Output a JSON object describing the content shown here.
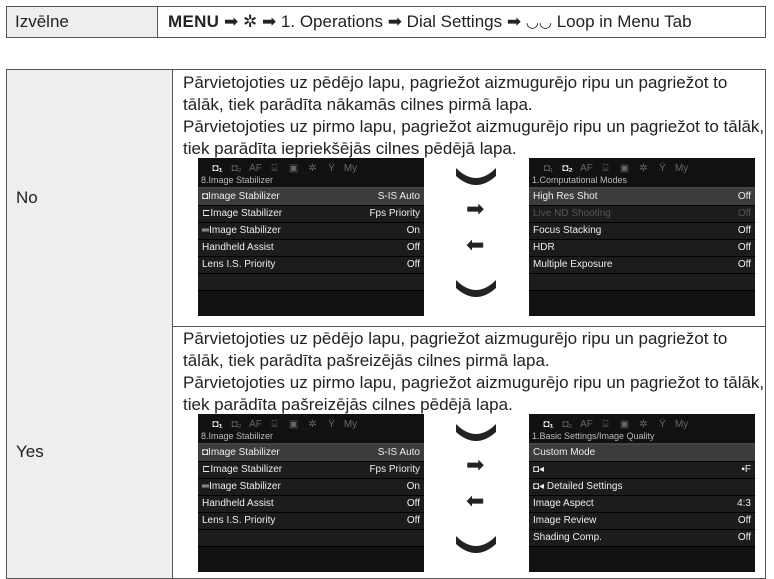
{
  "header": {
    "label": "Izvēlne",
    "path_menu": "MENU",
    "path_rest": "1. Operations ➡ Dial Settings ➡ ",
    "path_end": "Loop in Menu Tab"
  },
  "rows": [
    {
      "label": "No",
      "desc1": "Pārvietojoties uz pēdējo lapu, pagriežot aizmugurējo ripu un pagriežot to tālāk, tiek parādīta nākamās cilnes pirmā lapa.",
      "desc2": "Pārvietojoties uz pirmo lapu, pagriežot aizmugurējo ripu un pagriežot to tālāk, tiek parādīta iepriekšējās cilnes pēdējā lapa.",
      "left_menu": {
        "title": "8.Image Stabilizer",
        "items": [
          {
            "label": "Image Stabilizer",
            "value": "S-IS Auto"
          },
          {
            "label": "Image Stabilizer",
            "value": "Fps Priority"
          },
          {
            "label": "Image Stabilizer",
            "value": "On"
          },
          {
            "label": "Handheld Assist",
            "value": "Off"
          },
          {
            "label": "Lens I.S. Priority",
            "value": "Off"
          }
        ]
      },
      "right_menu": {
        "title": "1.Computational Modes",
        "items": [
          {
            "label": "High Res Shot",
            "value": "Off"
          },
          {
            "label": "Live ND Shooting",
            "value": "Off"
          },
          {
            "label": "Focus Stacking",
            "value": "Off"
          },
          {
            "label": "HDR",
            "value": "Off"
          },
          {
            "label": "Multiple Exposure",
            "value": "Off"
          }
        ]
      }
    },
    {
      "label": "Yes",
      "desc1": "Pārvietojoties uz pēdējo lapu, pagriežot aizmugurējo ripu un pagriežot to tālāk, tiek parādīta pašreizējās cilnes pirmā lapa.",
      "desc2": "Pārvietojoties uz pirmo lapu, pagriežot aizmugurējo ripu un pagriežot to tālāk, tiek parādīta pašreizējās cilnes pēdējā lapa.",
      "left_menu": {
        "title": "8.Image Stabilizer",
        "items": [
          {
            "label": "Image Stabilizer",
            "value": "S-IS Auto"
          },
          {
            "label": "Image Stabilizer",
            "value": "Fps Priority"
          },
          {
            "label": "Image Stabilizer",
            "value": "On"
          },
          {
            "label": "Handheld Assist",
            "value": "Off"
          },
          {
            "label": "Lens I.S. Priority",
            "value": "Off"
          }
        ]
      },
      "right_menu": {
        "title": "1.Basic Settings/Image Quality",
        "items": [
          {
            "label": "Custom Mode",
            "value": ""
          },
          {
            "label": "",
            "value": "F"
          },
          {
            "label": "Detailed Settings",
            "value": ""
          },
          {
            "label": "Image Aspect",
            "value": "4:3"
          },
          {
            "label": "Image Review",
            "value": "Off"
          },
          {
            "label": "Shading Comp.",
            "value": "Off"
          }
        ]
      }
    }
  ],
  "tab_labels": [
    "AF",
    "My"
  ]
}
